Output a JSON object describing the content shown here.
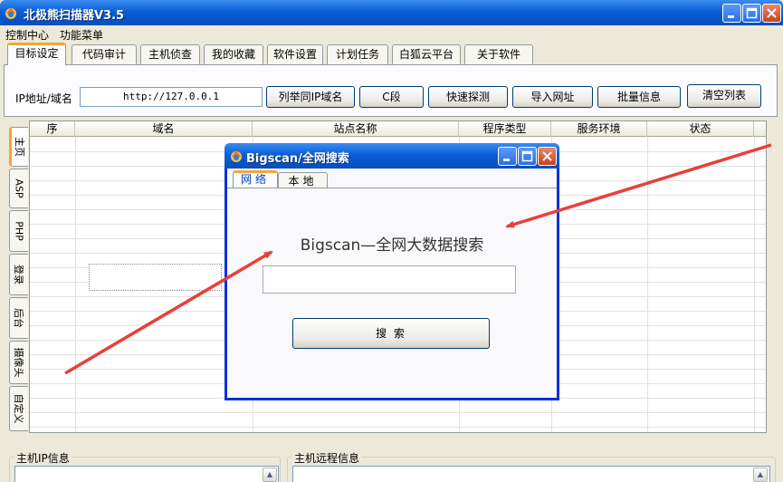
{
  "window": {
    "title": "北极熊扫描器V3.5",
    "colors": {
      "titlebar": "#0a5fd8",
      "accent_tab": "#f3a53b",
      "arrow": "#e8403a"
    }
  },
  "menu": [
    "控制中心",
    "功能菜单"
  ],
  "tabs": [
    {
      "label": "目标设定",
      "active": true
    },
    {
      "label": "代码审计"
    },
    {
      "label": "主机侦查"
    },
    {
      "label": "我的收藏"
    },
    {
      "label": "软件设置"
    },
    {
      "label": "计划任务"
    },
    {
      "label": "白狐云平台"
    },
    {
      "label": "关于软件"
    }
  ],
  "target": {
    "ip_label": "IP地址/域名",
    "ip_value": "http://127.0.0.1",
    "buttons": [
      "列举同IP域名",
      "C段",
      "快速探测",
      "导入网址",
      "批量信息",
      "清空列表"
    ]
  },
  "side_tabs": [
    {
      "label": "主页",
      "active": true
    },
    {
      "label": "ASP"
    },
    {
      "label": "PHP"
    },
    {
      "label": "登录"
    },
    {
      "label": "后台"
    },
    {
      "label": "摄像头"
    },
    {
      "label": "自定义"
    }
  ],
  "table": {
    "columns": [
      "序",
      "域名",
      "站点名称",
      "程序类型",
      "服务环境",
      "状态"
    ]
  },
  "bottom": {
    "left_title": "主机IP信息",
    "right_title": "主机远程信息"
  },
  "dialog": {
    "title": "Bigscan/全网搜索",
    "tabs": [
      {
        "label": "网络",
        "active": true
      },
      {
        "label": "本地"
      }
    ],
    "heading": "Bigscan—全网大数据搜索",
    "search_value": "",
    "search_button": "搜 索"
  }
}
